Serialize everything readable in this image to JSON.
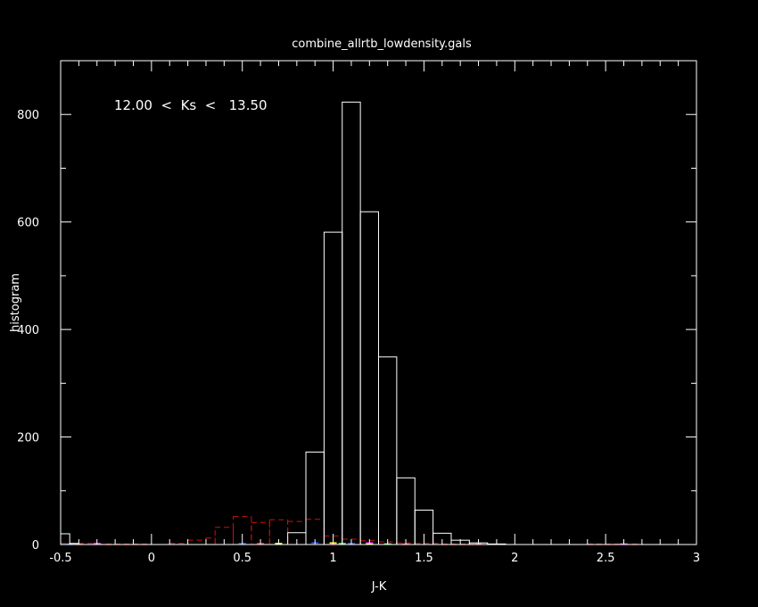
{
  "chart_data": {
    "type": "bar",
    "title": "combine_allrtb_lowdensity.gals",
    "xlabel": "J-K",
    "ylabel": "histogram",
    "annotation": "12.00  <  Ks  <   13.50",
    "xlim": [
      -0.5,
      3
    ],
    "ylim": [
      0,
      900
    ],
    "x_ticks": [
      -0.5,
      0,
      0.5,
      1,
      1.5,
      2,
      2.5,
      3
    ],
    "x_tick_labels": [
      "-0.5",
      "0",
      "0.5",
      "1",
      "1.5",
      "2",
      "2.5",
      "3"
    ],
    "y_ticks": [
      0,
      200,
      400,
      600,
      800
    ],
    "y_tick_labels": [
      "0",
      "200",
      "400",
      "600",
      "800"
    ],
    "grid": false,
    "colors": {
      "background": "#000000",
      "axes": "#ffffff",
      "main_series": "#ffffff",
      "dashed_series": "#cc1111"
    },
    "series": [
      {
        "style": "solid",
        "color": "#ffffff",
        "bins": [
          {
            "x0": -0.5,
            "x1": -0.45,
            "y": 20
          },
          {
            "x0": -0.45,
            "x1": -0.4,
            "y": 2
          },
          {
            "x0": 0.75,
            "x1": 0.85,
            "y": 22
          },
          {
            "x0": 0.85,
            "x1": 0.95,
            "y": 172
          },
          {
            "x0": 0.95,
            "x1": 1.05,
            "y": 581
          },
          {
            "x0": 1.05,
            "x1": 1.15,
            "y": 823
          },
          {
            "x0": 1.15,
            "x1": 1.25,
            "y": 619
          },
          {
            "x0": 1.25,
            "x1": 1.35,
            "y": 349
          },
          {
            "x0": 1.35,
            "x1": 1.45,
            "y": 124
          },
          {
            "x0": 1.45,
            "x1": 1.55,
            "y": 64
          },
          {
            "x0": 1.55,
            "x1": 1.65,
            "y": 21
          },
          {
            "x0": 1.65,
            "x1": 1.75,
            "y": 8
          },
          {
            "x0": 1.75,
            "x1": 1.85,
            "y": 3
          },
          {
            "x0": 1.85,
            "x1": 1.95,
            "y": 1
          }
        ]
      },
      {
        "style": "dashed",
        "color": "#cc1111",
        "bins": [
          {
            "x0": -0.5,
            "x1": -0.3,
            "y": 2
          },
          {
            "x0": -0.3,
            "x1": 0.0,
            "y": 1
          },
          {
            "x0": 0.1,
            "x1": 0.2,
            "y": 2
          },
          {
            "x0": 0.2,
            "x1": 0.3,
            "y": 8
          },
          {
            "x0": 0.3,
            "x1": 0.35,
            "y": 12
          },
          {
            "x0": 0.35,
            "x1": 0.45,
            "y": 32
          },
          {
            "x0": 0.45,
            "x1": 0.55,
            "y": 52
          },
          {
            "x0": 0.55,
            "x1": 0.65,
            "y": 41
          },
          {
            "x0": 0.65,
            "x1": 0.75,
            "y": 46
          },
          {
            "x0": 0.75,
            "x1": 0.85,
            "y": 43
          },
          {
            "x0": 0.85,
            "x1": 0.95,
            "y": 47
          },
          {
            "x0": 0.95,
            "x1": 1.05,
            "y": 16
          },
          {
            "x0": 1.05,
            "x1": 1.15,
            "y": 10
          },
          {
            "x0": 1.15,
            "x1": 1.25,
            "y": 7
          },
          {
            "x0": 1.25,
            "x1": 1.35,
            "y": 5
          },
          {
            "x0": 1.35,
            "x1": 1.45,
            "y": 3
          },
          {
            "x0": 1.45,
            "x1": 1.6,
            "y": 2
          },
          {
            "x0": 1.6,
            "x1": 1.8,
            "y": 1
          },
          {
            "x0": 2.4,
            "x1": 2.7,
            "y": 1
          }
        ]
      }
    ],
    "minor_traces": [
      {
        "color": "#2255ff",
        "points": [
          [
            -0.45,
            1
          ],
          [
            0.5,
            2
          ],
          [
            0.9,
            3
          ],
          [
            1.1,
            2
          ],
          [
            1.3,
            1
          ]
        ]
      },
      {
        "color": "#ff2222",
        "points": [
          [
            -0.4,
            1
          ],
          [
            0.6,
            2
          ],
          [
            1.0,
            2
          ],
          [
            1.4,
            1
          ],
          [
            1.8,
            1
          ]
        ]
      },
      {
        "color": "#ffff33",
        "points": [
          [
            0.7,
            2
          ],
          [
            1.0,
            3
          ],
          [
            1.2,
            2
          ]
        ]
      },
      {
        "color": "#ff33ff",
        "points": [
          [
            -0.3,
            2
          ],
          [
            1.2,
            3
          ],
          [
            2.6,
            1
          ]
        ]
      },
      {
        "color": "#33ff33",
        "points": [
          [
            1.05,
            2
          ],
          [
            1.3,
            1
          ]
        ]
      }
    ]
  }
}
